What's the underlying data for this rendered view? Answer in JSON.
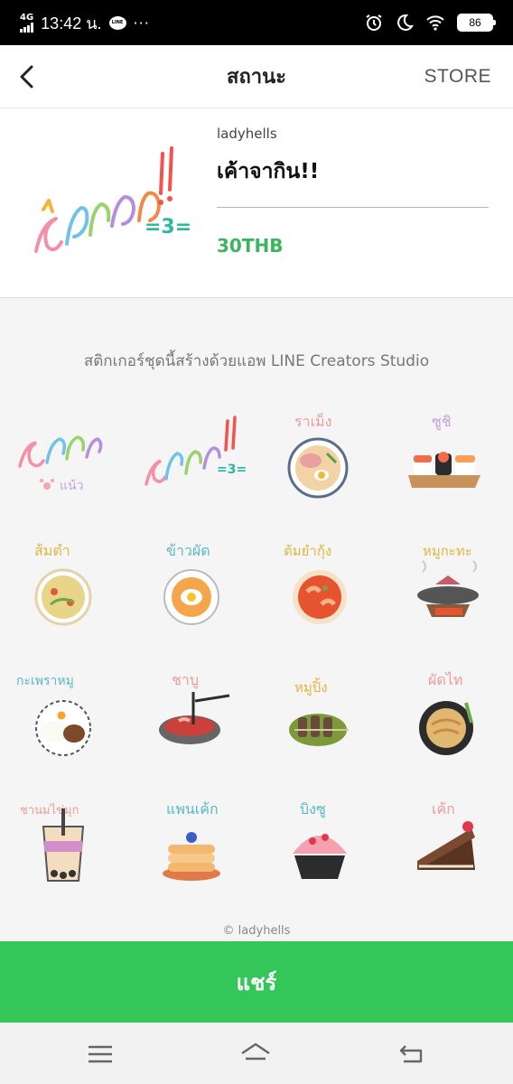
{
  "status_bar": {
    "network": "4G",
    "time": "13:42 น.",
    "line_badge": "LINE",
    "more": "···",
    "battery": "86"
  },
  "header": {
    "title": "สถานะ",
    "store_label": "STORE"
  },
  "product": {
    "creator": "ladyhells",
    "name": "เค้าจากิน!!",
    "price": "30THB"
  },
  "note": "สติกเกอร์ชุดนี้สร้างด้วยแอพ LINE Creators Studio",
  "stickers": [
    {
      "label": "เค้าหิวแน้ว",
      "icon": "hungry-text-sticker"
    },
    {
      "label": "เค้าจากิน",
      "icon": "eat-text-sticker"
    },
    {
      "label": "ราเม็ง",
      "icon": "ramen-sticker"
    },
    {
      "label": "ซูชิ",
      "icon": "sushi-sticker"
    },
    {
      "label": "ส้มตำ",
      "icon": "papaya-salad-sticker"
    },
    {
      "label": "ข้าวผัด",
      "icon": "fried-rice-sticker"
    },
    {
      "label": "ต้มยำกุ้ง",
      "icon": "tom-yum-sticker"
    },
    {
      "label": "หมูกะทะ",
      "icon": "bbq-grill-sticker"
    },
    {
      "label": "กะเพราหมู",
      "icon": "basil-pork-sticker"
    },
    {
      "label": "ชาบู",
      "icon": "shabu-sticker"
    },
    {
      "label": "หมูปิ้ง",
      "icon": "grilled-pork-sticker"
    },
    {
      "label": "ผัดไท",
      "icon": "pad-thai-sticker"
    },
    {
      "label": "ชานมไข่มุก",
      "icon": "bubble-tea-sticker"
    },
    {
      "label": "แพนเค้ก",
      "icon": "pancake-sticker"
    },
    {
      "label": "บิงซู",
      "icon": "bingsu-sticker"
    },
    {
      "label": "เค้ก",
      "icon": "cake-sticker"
    }
  ],
  "copyright": "© ladyhells",
  "share_label": "แชร์",
  "colors": {
    "line_green": "#35c659",
    "price_green": "#3ab65f"
  }
}
